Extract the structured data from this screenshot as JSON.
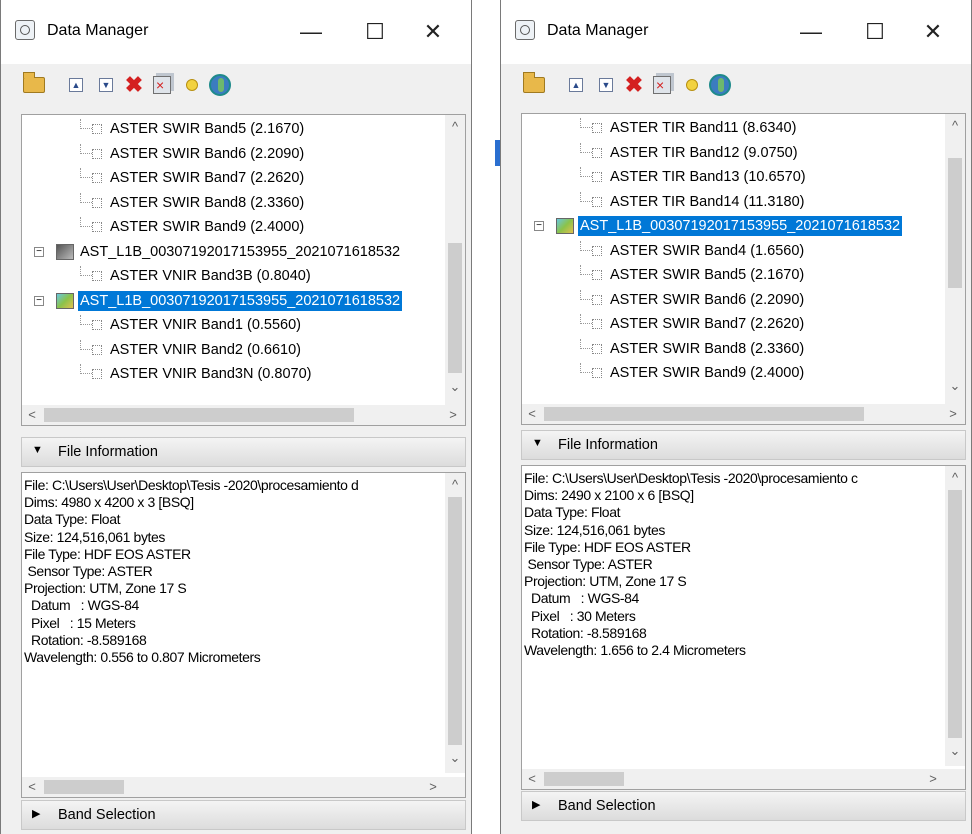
{
  "windows": [
    {
      "title": "Data Manager",
      "controls": {
        "minimize": "—",
        "maximize": "☐",
        "close": "✕"
      },
      "tree": [
        {
          "kind": "band",
          "label": "ASTER SWIR Band5 (2.1670)"
        },
        {
          "kind": "band",
          "label": "ASTER SWIR Band6 (2.2090)"
        },
        {
          "kind": "band",
          "label": "ASTER SWIR Band7 (2.2620)"
        },
        {
          "kind": "band",
          "label": "ASTER SWIR Band8 (2.3360)"
        },
        {
          "kind": "band",
          "label": "ASTER SWIR Band9 (2.4000)"
        },
        {
          "kind": "file",
          "label": "AST_L1B_00307192017153955_2021071618532",
          "icon": "gray",
          "selected": false
        },
        {
          "kind": "band",
          "label": "ASTER VNIR Band3B (0.8040)"
        },
        {
          "kind": "file",
          "label": "AST_L1B_00307192017153955_2021071618532",
          "icon": "color",
          "selected": true
        },
        {
          "kind": "band",
          "label": "ASTER VNIR Band1 (0.5560)"
        },
        {
          "kind": "band",
          "label": "ASTER VNIR Band2 (0.6610)"
        },
        {
          "kind": "band",
          "label": "ASTER VNIR Band3N (0.8070)"
        }
      ],
      "file_information_label": "File Information",
      "info_lines": [
        "File: C:\\Users\\User\\Desktop\\Tesis -2020\\procesamiento d",
        "Dims: 4980 x 4200 x 3 [BSQ]",
        "Data Type: Float",
        "Size: 124,516,061 bytes",
        "File Type: HDF EOS ASTER",
        " Sensor Type: ASTER",
        "Projection: UTM, Zone 17 S",
        "  Datum   : WGS-84",
        "  Pixel   : 15 Meters",
        "  Rotation: -8.589168",
        "Wavelength: 0.556 to 0.807 Micrometers"
      ],
      "band_selection_label": "Band Selection"
    },
    {
      "title": "Data Manager",
      "controls": {
        "minimize": "—",
        "maximize": "☐",
        "close": "✕"
      },
      "tree": [
        {
          "kind": "band",
          "label": "ASTER TIR Band11 (8.6340)"
        },
        {
          "kind": "band",
          "label": "ASTER TIR Band12 (9.0750)"
        },
        {
          "kind": "band",
          "label": "ASTER TIR Band13 (10.6570)"
        },
        {
          "kind": "band",
          "label": "ASTER TIR Band14 (11.3180)"
        },
        {
          "kind": "file",
          "label": "AST_L1B_00307192017153955_2021071618532",
          "icon": "color",
          "selected": true
        },
        {
          "kind": "band",
          "label": "ASTER SWIR Band4 (1.6560)"
        },
        {
          "kind": "band",
          "label": "ASTER SWIR Band5 (2.1670)"
        },
        {
          "kind": "band",
          "label": "ASTER SWIR Band6 (2.2090)"
        },
        {
          "kind": "band",
          "label": "ASTER SWIR Band7 (2.2620)"
        },
        {
          "kind": "band",
          "label": "ASTER SWIR Band8 (2.3360)"
        },
        {
          "kind": "band",
          "label": "ASTER SWIR Band9 (2.4000)"
        }
      ],
      "file_information_label": "File Information",
      "info_lines": [
        "File: C:\\Users\\User\\Desktop\\Tesis -2020\\procesamiento c",
        "Dims: 2490 x 2100 x 6 [BSQ]",
        "Data Type: Float",
        "Size: 124,516,061 bytes",
        "File Type: HDF EOS ASTER",
        " Sensor Type: ASTER",
        "Projection: UTM, Zone 17 S",
        "  Datum   : WGS-84",
        "  Pixel   : 30 Meters",
        "  Rotation: -8.589168",
        "Wavelength: 1.656 to 2.4 Micrometers"
      ],
      "band_selection_label": "Band Selection"
    }
  ],
  "toolbar_icons": [
    "open-icon",
    "collapse-icon",
    "expand-icon",
    "close-file-icon",
    "close-all-icon",
    "pin-icon",
    "globe-icon"
  ],
  "colors": {
    "selection": "#0078d7",
    "window_bg": "#f0f0f0"
  }
}
